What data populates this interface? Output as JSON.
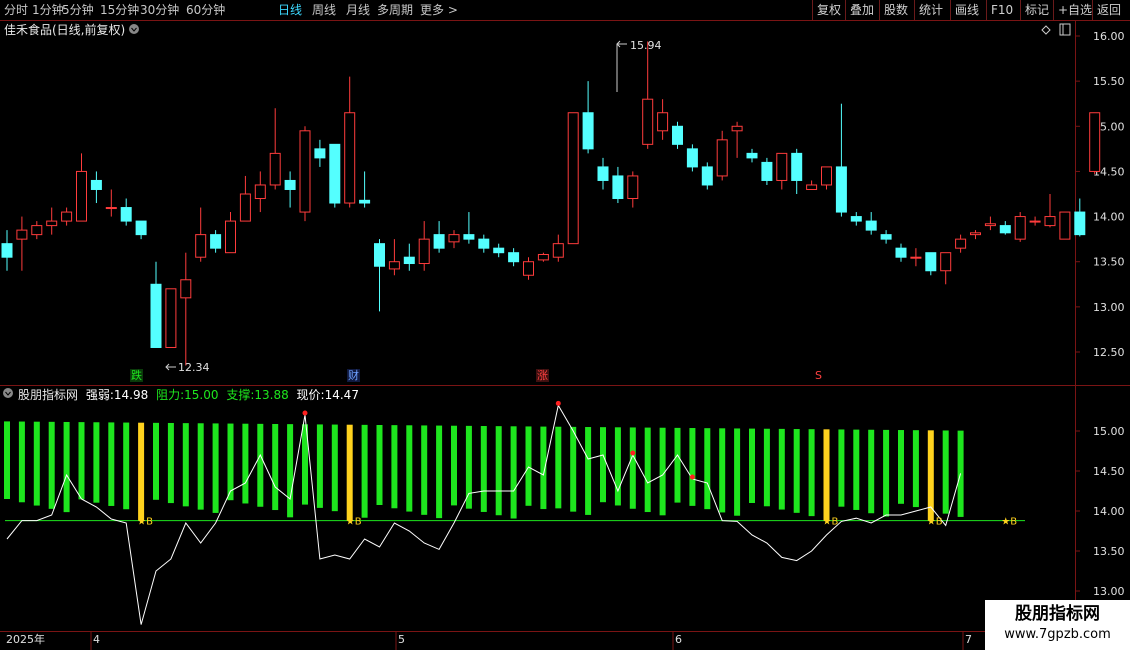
{
  "toolbar": {
    "periods": [
      "分时",
      "1分钟",
      "5分钟",
      "15分钟",
      "30分钟",
      "60分钟",
      "日线",
      "周线",
      "月线",
      "多周期",
      "更多 >"
    ],
    "active_index": 6,
    "right_buttons": [
      "复权",
      "叠加",
      "股数",
      "统计",
      "画线",
      "F10",
      "标记",
      "+自选",
      "返回"
    ]
  },
  "stock": {
    "title": "佳禾食品(日线,前复权)"
  },
  "indicator": {
    "name": "股朋指标网",
    "qiangruo_label": "强弱:",
    "qiangruo": "14.98",
    "zuli_label": "阻力:",
    "zuli": "15.00",
    "zhicheng_label": "支撑:",
    "zhicheng": "13.88",
    "xianjia_label": "现价:",
    "xianjia": "14.47"
  },
  "markers": {
    "high": "15.94",
    "low": "12.34",
    "die": "跌",
    "cai": "财",
    "zhang": "涨",
    "s": "S",
    "buy": "B"
  },
  "price_axis": [
    "16.00",
    "15.50",
    "15.00",
    "14.50",
    "14.00",
    "13.50",
    "13.00",
    "12.50"
  ],
  "ind_axis": [
    "15.00",
    "14.50",
    "14.00",
    "13.50",
    "13.00"
  ],
  "date_axis": {
    "year": "2025年",
    "months": [
      "4",
      "5",
      "6",
      "7"
    ]
  },
  "watermark": {
    "line1": "股朋指标网",
    "line2": "www.7gpzb.com"
  },
  "colors": {
    "up": "#ff3c3c",
    "down": "#54ffff",
    "bar_green": "#1ee61e",
    "bar_yellow": "#ffd21e",
    "line": "#ffffff",
    "support": "#1ee61e",
    "frame": "#7a1414"
  },
  "chart_data": {
    "type": "candlestick",
    "ylim": [
      12.3,
      16.05
    ],
    "candles": [
      [
        13.7,
        13.55,
        13.85,
        13.4
      ],
      [
        13.75,
        13.85,
        14.0,
        13.4
      ],
      [
        13.8,
        13.9,
        13.95,
        13.75
      ],
      [
        13.9,
        13.95,
        14.1,
        13.8
      ],
      [
        13.95,
        14.05,
        14.1,
        13.9
      ],
      [
        13.95,
        14.5,
        14.7,
        13.95
      ],
      [
        14.4,
        14.3,
        14.5,
        14.15
      ],
      [
        14.1,
        14.1,
        14.3,
        14.0
      ],
      [
        14.1,
        13.95,
        14.2,
        13.9
      ],
      [
        13.95,
        13.8,
        13.95,
        13.75
      ],
      [
        13.25,
        12.55,
        13.5,
        12.55
      ],
      [
        12.55,
        13.2,
        13.2,
        12.55
      ],
      [
        13.1,
        13.3,
        13.6,
        12.35
      ],
      [
        13.55,
        13.8,
        14.1,
        13.5
      ],
      [
        13.8,
        13.65,
        13.85,
        13.6
      ],
      [
        13.6,
        13.95,
        14.05,
        13.6
      ],
      [
        13.95,
        14.25,
        14.45,
        13.95
      ],
      [
        14.2,
        14.35,
        14.5,
        14.05
      ],
      [
        14.35,
        14.7,
        15.2,
        14.3
      ],
      [
        14.4,
        14.3,
        14.5,
        14.1
      ],
      [
        14.05,
        14.95,
        15.0,
        13.95
      ],
      [
        14.75,
        14.65,
        14.85,
        14.55
      ],
      [
        14.8,
        14.15,
        14.8,
        14.1
      ],
      [
        14.15,
        15.15,
        15.55,
        14.1
      ],
      [
        14.18,
        14.15,
        14.5,
        14.1
      ],
      [
        13.7,
        13.45,
        13.75,
        12.95
      ],
      [
        13.42,
        13.5,
        13.75,
        13.35
      ],
      [
        13.55,
        13.48,
        13.7,
        13.4
      ],
      [
        13.48,
        13.75,
        13.95,
        13.4
      ],
      [
        13.8,
        13.65,
        13.95,
        13.6
      ],
      [
        13.72,
        13.8,
        13.85,
        13.65
      ],
      [
        13.8,
        13.75,
        14.05,
        13.7
      ],
      [
        13.75,
        13.65,
        13.8,
        13.6
      ],
      [
        13.65,
        13.6,
        13.7,
        13.55
      ],
      [
        13.6,
        13.5,
        13.65,
        13.45
      ],
      [
        13.35,
        13.5,
        13.55,
        13.3
      ],
      [
        13.52,
        13.58,
        13.6,
        13.5
      ],
      [
        13.55,
        13.7,
        13.8,
        13.5
      ],
      [
        13.7,
        15.15,
        15.15,
        13.7
      ],
      [
        15.15,
        14.75,
        15.5,
        14.7
      ],
      [
        14.55,
        14.4,
        14.65,
        14.3
      ],
      [
        14.45,
        14.2,
        14.55,
        14.15
      ],
      [
        14.2,
        14.45,
        14.5,
        14.1
      ],
      [
        14.8,
        15.3,
        15.94,
        14.75
      ],
      [
        14.95,
        15.15,
        15.3,
        14.85
      ],
      [
        15.0,
        14.8,
        15.05,
        14.75
      ],
      [
        14.75,
        14.55,
        14.8,
        14.5
      ],
      [
        14.55,
        14.35,
        14.6,
        14.3
      ],
      [
        14.45,
        14.85,
        14.95,
        14.4
      ],
      [
        14.95,
        15.0,
        15.05,
        14.65
      ],
      [
        14.7,
        14.65,
        14.75,
        14.6
      ],
      [
        14.6,
        14.4,
        14.65,
        14.35
      ],
      [
        14.4,
        14.7,
        14.7,
        14.3
      ],
      [
        14.7,
        14.4,
        14.75,
        14.25
      ],
      [
        14.3,
        14.35,
        14.4,
        14.3
      ],
      [
        14.35,
        14.55,
        14.55,
        14.3
      ],
      [
        14.55,
        14.05,
        15.25,
        14.0
      ],
      [
        14.0,
        13.95,
        14.05,
        13.9
      ],
      [
        13.95,
        13.85,
        14.05,
        13.8
      ],
      [
        13.8,
        13.75,
        13.85,
        13.7
      ],
      [
        13.65,
        13.55,
        13.7,
        13.5
      ],
      [
        13.55,
        13.55,
        13.65,
        13.45
      ],
      [
        13.6,
        13.4,
        13.6,
        13.35
      ],
      [
        13.4,
        13.6,
        13.6,
        13.25
      ],
      [
        13.65,
        13.75,
        13.8,
        13.6
      ],
      [
        13.8,
        13.82,
        13.85,
        13.75
      ],
      [
        13.9,
        13.92,
        14.0,
        13.85
      ],
      [
        13.9,
        13.82,
        13.95,
        13.8
      ],
      [
        13.75,
        14.0,
        14.05,
        13.72
      ],
      [
        13.95,
        13.95,
        14.0,
        13.9
      ],
      [
        13.9,
        14.0,
        14.25,
        13.88
      ],
      [
        13.75,
        14.05,
        14.05,
        13.75
      ],
      [
        14.05,
        13.8,
        14.2,
        13.78
      ],
      [
        14.5,
        15.15,
        15.15,
        14.47
      ]
    ],
    "indicator_values": {
      "support": 13.88,
      "resistance": 15.0,
      "strength": [
        13.65,
        13.88,
        13.88,
        13.95,
        14.45,
        14.15,
        14.05,
        13.9,
        13.85,
        12.58,
        13.25,
        13.4,
        13.85,
        13.6,
        13.85,
        14.25,
        14.35,
        14.7,
        14.3,
        14.15,
        15.2,
        13.4,
        13.45,
        13.4,
        13.65,
        13.55,
        13.85,
        13.75,
        13.6,
        13.52,
        13.85,
        14.22,
        14.25,
        14.25,
        14.25,
        14.55,
        14.45,
        15.32,
        15.0,
        14.65,
        14.7,
        14.25,
        14.7,
        14.35,
        14.45,
        14.7,
        14.4,
        14.35,
        13.88,
        13.87,
        13.7,
        13.6,
        13.42,
        13.38,
        13.5,
        13.7,
        13.87,
        13.91,
        13.85,
        13.95,
        13.95,
        14.0,
        14.05,
        13.82,
        14.47
      ]
    },
    "month_labels": [
      "4",
      "5",
      "6",
      "7"
    ],
    "xlabel": "",
    "ylabel": ""
  }
}
